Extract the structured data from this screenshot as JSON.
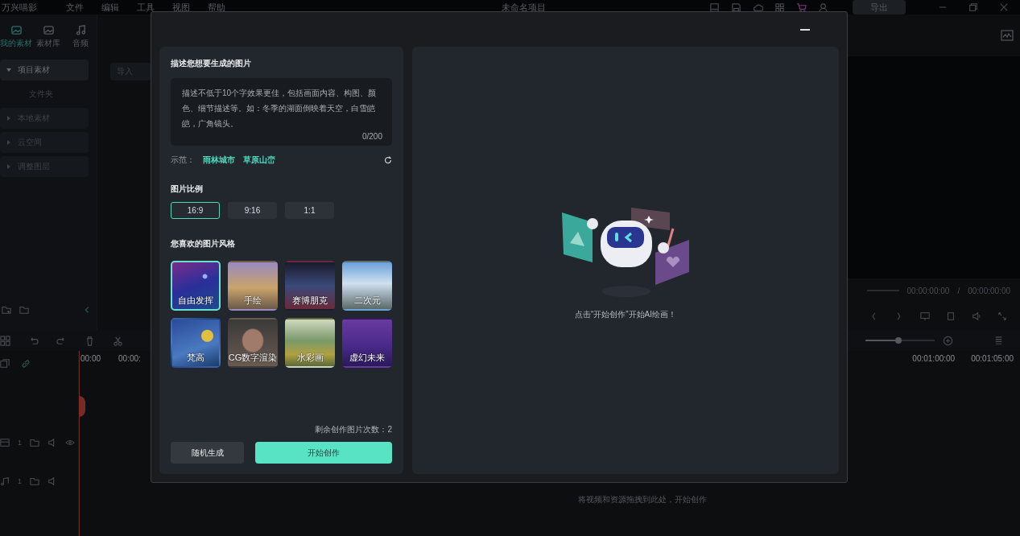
{
  "app": {
    "logo_text": "万兴喵影",
    "menu": [
      "文件",
      "编辑",
      "工具",
      "视图",
      "帮助"
    ],
    "project_title": "未命名项目",
    "export_label": "导出"
  },
  "media_tabs": [
    {
      "label": "我的素材",
      "selected": true
    },
    {
      "label": "素材库",
      "selected": false
    },
    {
      "label": "音频",
      "selected": false
    }
  ],
  "media_tree": [
    {
      "label": "项目素材",
      "expanded": true,
      "children": [
        {
          "label": "文件夹"
        }
      ]
    },
    {
      "label": "本地素材",
      "expanded": false
    },
    {
      "label": "云空间",
      "expanded": false
    },
    {
      "label": "调整图层",
      "expanded": false
    }
  ],
  "import_button": "导入",
  "preview": {
    "current_time": "00:00:00:00",
    "separator": "/",
    "total_time": "00:00:00:00"
  },
  "timeline": {
    "zoom_slider": {
      "level": 0.48
    },
    "ruler_left": [
      "00:00",
      "00:00:"
    ],
    "ruler_right": [
      "00:01:00:00",
      "00:01:05:00"
    ],
    "tracks": [
      {
        "kind": "video",
        "number": "1"
      },
      {
        "kind": "audio",
        "number": "1"
      }
    ],
    "drop_hint": "将视频和资源拖拽到此处，开始创作"
  },
  "dialog": {
    "prompt": {
      "heading": "描述您想要生成的图片",
      "placeholder": "描述不低于10个字效果更佳，包括画面内容、构图、颜色、细节描述等。如：冬季的湖面倒映着天空，白雪皑皑，广角镜头。",
      "counter": "0/200"
    },
    "examples": {
      "label": "示范：",
      "items": [
        "雨林城市",
        "草原山峦"
      ]
    },
    "ratio": {
      "heading": "图片比例",
      "options": [
        {
          "label": "16:9",
          "selected": true
        },
        {
          "label": "9:16",
          "selected": false
        },
        {
          "label": "1:1",
          "selected": false
        }
      ]
    },
    "styles": {
      "heading": "您喜欢的图片风格",
      "items": [
        {
          "label": "自由发挥",
          "selected": true
        },
        {
          "label": "手绘",
          "selected": false
        },
        {
          "label": "赛博朋克",
          "selected": false
        },
        {
          "label": "二次元",
          "selected": false
        },
        {
          "label": "梵高",
          "selected": false
        },
        {
          "label": "CG数字渲染",
          "selected": false
        },
        {
          "label": "水彩画",
          "selected": false
        },
        {
          "label": "虚幻未来",
          "selected": false
        }
      ]
    },
    "remaining": "剩余创作图片次数：2",
    "random_button": "随机生成",
    "start_button": "开始创作",
    "hint": "点击“开始创作”开始AI绘画！"
  }
}
